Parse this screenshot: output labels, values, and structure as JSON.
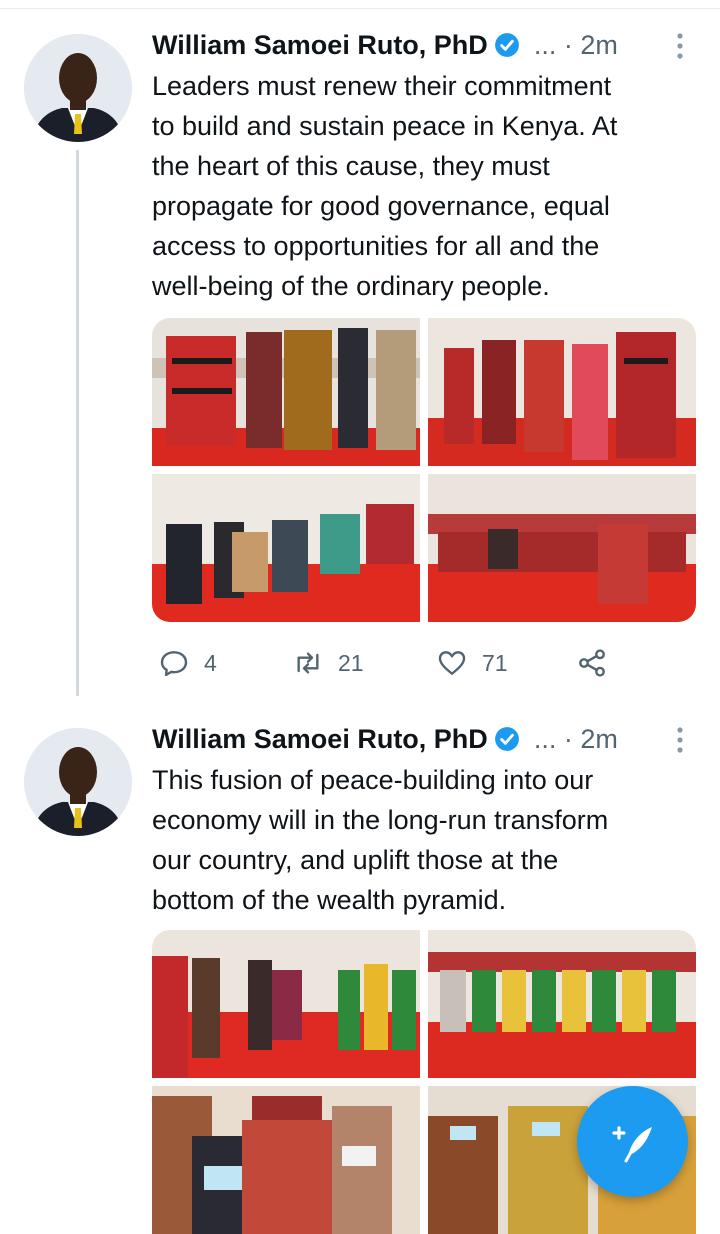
{
  "tweets": [
    {
      "author": "William Samoei Ruto, PhD",
      "ellipsis": "...",
      "separator": "·",
      "time": "2m",
      "text": [
        "Leaders must renew their commitment",
        "to build and sustain peace in Kenya. At",
        "the heart of this cause, they must",
        "propagate for good governance, equal",
        "access to opportunities for all and the",
        "well-being of the ordinary people."
      ],
      "replies": "4",
      "retweets": "21",
      "likes": "71"
    },
    {
      "author": "William Samoei Ruto, PhD",
      "ellipsis": "...",
      "separator": "·",
      "time": "2m",
      "text": [
        "This fusion of peace-building into our",
        "economy will in the long-run transform",
        "our country, and uplift those at the",
        "bottom of the wealth pyramid."
      ]
    }
  ],
  "icons": {
    "verified": "verified-badge-icon",
    "more": "more-vertical-icon",
    "reply": "reply-icon",
    "retweet": "retweet-icon",
    "like": "heart-icon",
    "share": "share-icon",
    "compose": "compose-feather-icon"
  },
  "colors": {
    "accent": "#1d9bf0",
    "muted": "#536471",
    "text": "#0f1419",
    "thread_line": "#cfd9de"
  }
}
